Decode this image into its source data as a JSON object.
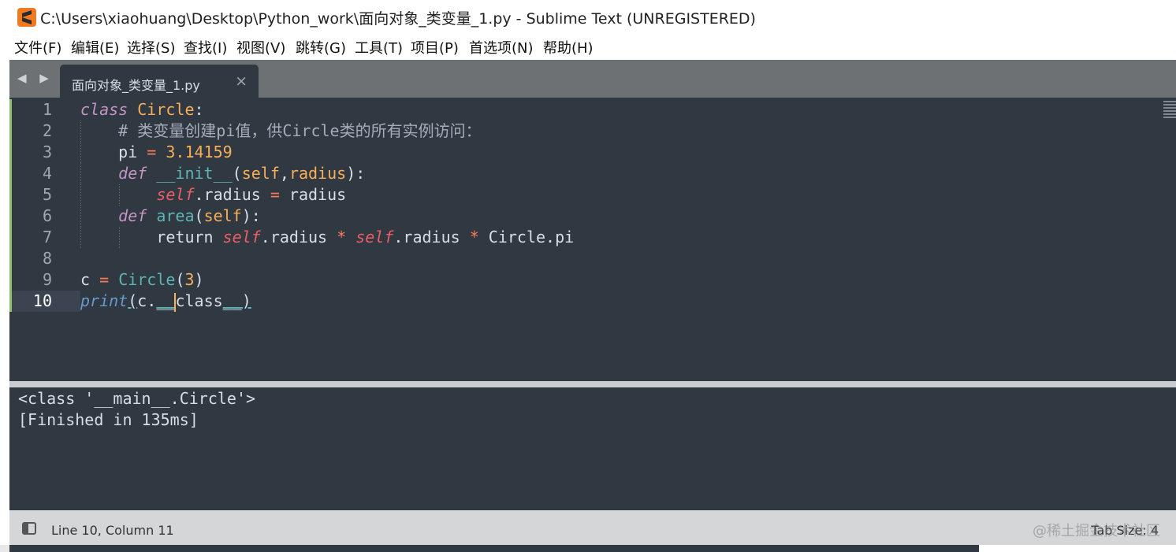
{
  "window": {
    "title": "C:\\Users\\xiaohuang\\Desktop\\Python_work\\面向对象_类变量_1.py - Sublime Text (UNREGISTERED)"
  },
  "menu": [
    "文件(F)",
    "编辑(E)",
    "选择(S)",
    "查找(I)",
    "视图(V)",
    "跳转(G)",
    "工具(T)",
    "项目(P)",
    "首选项(N)",
    "帮助(H)"
  ],
  "tabs": {
    "nav": "◀ ▶",
    "active": {
      "label": "面向对象_类变量_1.py",
      "close": "×"
    }
  },
  "editor": {
    "line_numbers": [
      "1",
      "2",
      "3",
      "4",
      "5",
      "6",
      "7",
      "8",
      "9",
      "10"
    ],
    "current_line": 10,
    "lines": [
      [
        {
          "t": "class",
          "c": "kw"
        },
        {
          "t": " "
        },
        {
          "t": "Circle",
          "c": "cls"
        },
        {
          "t": ":"
        }
      ],
      [
        {
          "t": "    "
        },
        {
          "t": "# 类变量创建pi值，供Circle类的所有实例访问：",
          "c": "cmt"
        }
      ],
      [
        {
          "t": "    pi "
        },
        {
          "t": "=",
          "c": "op"
        },
        {
          "t": " "
        },
        {
          "t": "3.14159",
          "c": "num"
        }
      ],
      [
        {
          "t": "    "
        },
        {
          "t": "def",
          "c": "kw"
        },
        {
          "t": " "
        },
        {
          "t": "__init__",
          "c": "fn"
        },
        {
          "t": "("
        },
        {
          "t": "self",
          "c": "param"
        },
        {
          "t": ","
        },
        {
          "t": "radius",
          "c": "param"
        },
        {
          "t": "):"
        }
      ],
      [
        {
          "t": "        "
        },
        {
          "t": "self",
          "c": "slf"
        },
        {
          "t": ".radius "
        },
        {
          "t": "=",
          "c": "op"
        },
        {
          "t": " radius"
        }
      ],
      [
        {
          "t": "    "
        },
        {
          "t": "def",
          "c": "kw"
        },
        {
          "t": " "
        },
        {
          "t": "area",
          "c": "fn"
        },
        {
          "t": "("
        },
        {
          "t": "self",
          "c": "param"
        },
        {
          "t": "):"
        }
      ],
      [
        {
          "t": "        return "
        },
        {
          "t": "self",
          "c": "slf"
        },
        {
          "t": ".radius "
        },
        {
          "t": "*",
          "c": "op"
        },
        {
          "t": " "
        },
        {
          "t": "self",
          "c": "slf"
        },
        {
          "t": ".radius "
        },
        {
          "t": "*",
          "c": "op"
        },
        {
          "t": " Circle.pi"
        }
      ],
      [],
      [
        {
          "t": "c "
        },
        {
          "t": "=",
          "c": "op"
        },
        {
          "t": " "
        },
        {
          "t": "Circle",
          "c": "fn"
        },
        {
          "t": "("
        },
        {
          "t": "3",
          "c": "num"
        },
        {
          "t": ")"
        }
      ],
      [
        {
          "t": "print",
          "c": "bi"
        },
        {
          "t": "(",
          "c": "u"
        },
        {
          "t": "c."
        },
        {
          "t": "__",
          "c": "u"
        },
        {
          "t": "|",
          "c": "cursor"
        },
        {
          "t": "class"
        },
        {
          "t": "__",
          "c": "u"
        },
        {
          "t": ")",
          "c": "u"
        }
      ]
    ]
  },
  "output": {
    "lines": [
      "<class '__main__.Circle'>",
      "[Finished in 135ms]"
    ]
  },
  "status": {
    "position": "Line 10, Column 11",
    "tab_size": "Tab Size: 4",
    "watermark": "@稀土掘金技术社区"
  },
  "colors": {
    "editor_bg": "#303841",
    "keyword": "#c594c5",
    "class_name": "#f9ae58",
    "function": "#5fb4b4",
    "self": "#ec5f66",
    "operator": "#f97b58"
  }
}
